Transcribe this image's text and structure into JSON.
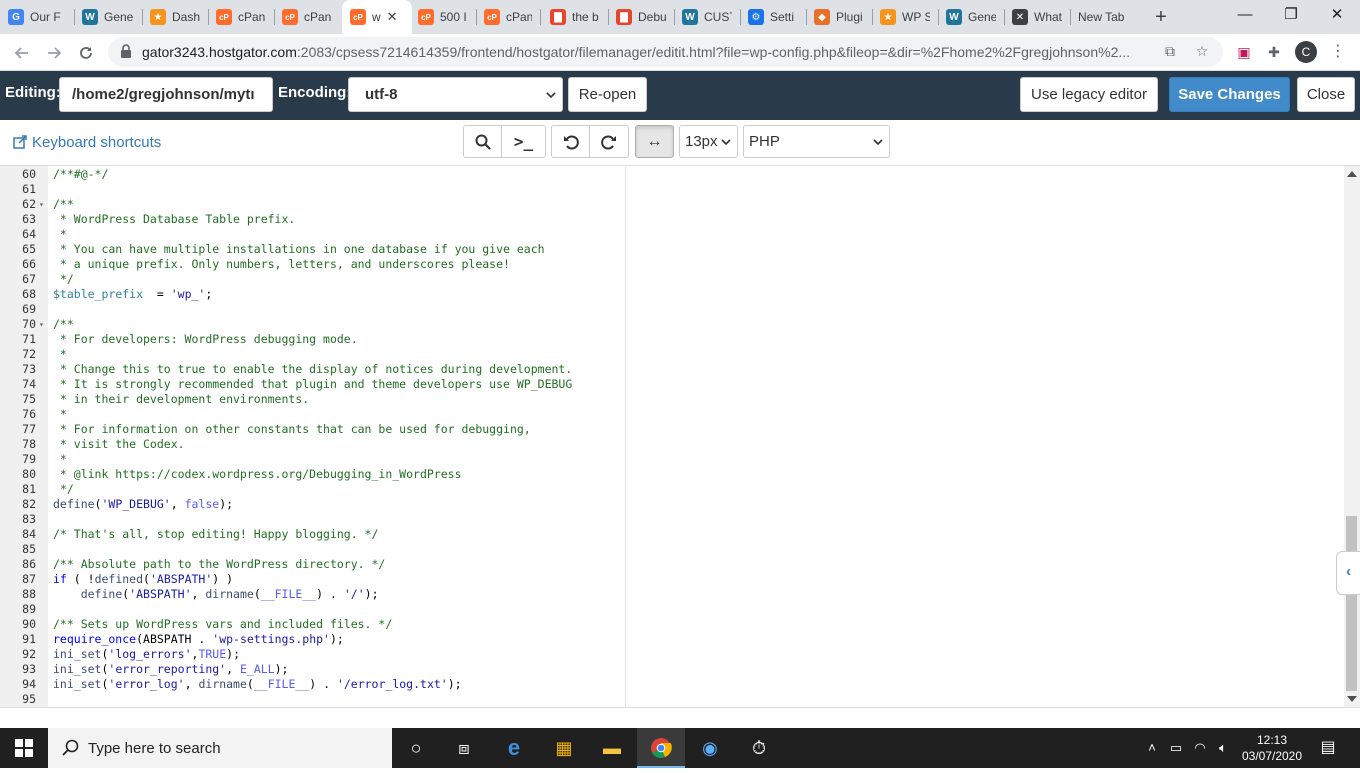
{
  "browser": {
    "tabs": [
      {
        "label": "Our F",
        "icon": "google-icon",
        "color": "#4285f4",
        "glyph": "G"
      },
      {
        "label": "Gene",
        "icon": "wordpress-icon",
        "color": "#21759b",
        "glyph": "W"
      },
      {
        "label": "Dash",
        "icon": "hostgator-icon",
        "color": "#f7941d",
        "glyph": "★"
      },
      {
        "label": "cPan",
        "icon": "cpanel-icon",
        "color": "#ff6c2c",
        "glyph": "cP"
      },
      {
        "label": "cPan",
        "icon": "cpanel-icon",
        "color": "#ff6c2c",
        "glyph": "cP"
      },
      {
        "label": "w",
        "icon": "cpanel-icon",
        "color": "#ff6c2c",
        "glyph": "cP"
      },
      {
        "label": "500 I",
        "icon": "cpanel-icon",
        "color": "#ff6c2c",
        "glyph": "cP"
      },
      {
        "label": "cPan",
        "icon": "cpanel-icon",
        "color": "#ff6c2c",
        "glyph": "cP"
      },
      {
        "label": "the b",
        "icon": "bag-icon",
        "color": "#e8452c",
        "glyph": "▇"
      },
      {
        "label": "Debu",
        "icon": "bag-icon",
        "color": "#e8452c",
        "glyph": "▇"
      },
      {
        "label": "CUST",
        "icon": "wordpress-icon",
        "color": "#21759b",
        "glyph": "W"
      },
      {
        "label": "Setti",
        "icon": "gear-icon",
        "color": "#1a73e8",
        "glyph": "⚙"
      },
      {
        "label": "Plugi",
        "icon": "plugin-icon",
        "color": "#e8702a",
        "glyph": "◆"
      },
      {
        "label": "WP S",
        "icon": "hostgator-icon",
        "color": "#f7941d",
        "glyph": "★"
      },
      {
        "label": "Gene",
        "icon": "wordpress-icon",
        "color": "#21759b",
        "glyph": "W"
      },
      {
        "label": "What",
        "icon": "crossed-icon",
        "color": "#3c4043",
        "glyph": "✕"
      },
      {
        "label": "New Tab",
        "icon": "",
        "color": "",
        "glyph": ""
      }
    ],
    "new_tab_label": "+",
    "window": {
      "minimize": "—",
      "restore": "❐",
      "close": "✕"
    },
    "url_host": "gator3243.hostgator.com",
    "url_rest": ":2083/cpsess7214614359/frontend/hostgator/filemanager/editit.html?file=wp-config.php&fileop=&dir=%2Fhome2%2Fgregjohnson%2...",
    "profile_initial": "C"
  },
  "header": {
    "editing_label": "Editing:",
    "path_value": "/home2/gregjohnson/mytı",
    "encoding_label": "Encoding:",
    "encoding_value": "utf-8",
    "reopen_label": "Re-open",
    "legacy_label": "Use legacy editor",
    "save_label": "Save Changes",
    "close_label": "Close"
  },
  "toolbar": {
    "shortcuts_label": "Keyboard shortcuts",
    "font_size": "13px",
    "language": "PHP"
  },
  "editor": {
    "lines": [
      {
        "n": "60",
        "fold": false,
        "html": "<span class=\"c\">/**#@-*/</span>"
      },
      {
        "n": "61",
        "fold": false,
        "html": ""
      },
      {
        "n": "62",
        "fold": true,
        "html": "<span class=\"c\">/**</span>"
      },
      {
        "n": "63",
        "fold": false,
        "html": "<span class=\"c\"> * WordPress Database Table prefix.</span>"
      },
      {
        "n": "64",
        "fold": false,
        "html": "<span class=\"c\"> *</span>"
      },
      {
        "n": "65",
        "fold": false,
        "html": "<span class=\"c\"> * You can have multiple installations in one database if you give each</span>"
      },
      {
        "n": "66",
        "fold": false,
        "html": "<span class=\"c\"> * a unique prefix. Only numbers, letters, and underscores please!</span>"
      },
      {
        "n": "67",
        "fold": false,
        "html": "<span class=\"c\"> */</span>"
      },
      {
        "n": "68",
        "fold": false,
        "html": "<span class=\"v\">$table_prefix</span>  = <span class=\"s\">'wp_'</span>;"
      },
      {
        "n": "69",
        "fold": false,
        "html": ""
      },
      {
        "n": "70",
        "fold": true,
        "html": "<span class=\"c\">/**</span>"
      },
      {
        "n": "71",
        "fold": false,
        "html": "<span class=\"c\"> * For developers: WordPress debugging mode.</span>"
      },
      {
        "n": "72",
        "fold": false,
        "html": "<span class=\"c\"> *</span>"
      },
      {
        "n": "73",
        "fold": false,
        "html": "<span class=\"c\"> * Change this to true to enable the display of notices during development.</span>"
      },
      {
        "n": "74",
        "fold": false,
        "html": "<span class=\"c\"> * It is strongly recommended that plugin and theme developers use WP_DEBUG</span>"
      },
      {
        "n": "75",
        "fold": false,
        "html": "<span class=\"c\"> * in their development environments.</span>"
      },
      {
        "n": "76",
        "fold": false,
        "html": "<span class=\"c\"> *</span>"
      },
      {
        "n": "77",
        "fold": false,
        "html": "<span class=\"c\"> * For information on other constants that can be used for debugging,</span>"
      },
      {
        "n": "78",
        "fold": false,
        "html": "<span class=\"c\"> * visit the Codex.</span>"
      },
      {
        "n": "79",
        "fold": false,
        "html": "<span class=\"c\"> *</span>"
      },
      {
        "n": "80",
        "fold": false,
        "html": "<span class=\"c\"> * @link https://codex.wordpress.org/Debugging_in_WordPress</span>"
      },
      {
        "n": "81",
        "fold": false,
        "html": "<span class=\"c\"> */</span>"
      },
      {
        "n": "82",
        "fold": false,
        "html": "<span class=\"f\">define</span>(<span class=\"s\">'WP_DEBUG'</span>, <span class=\"b\">false</span>);"
      },
      {
        "n": "83",
        "fold": false,
        "html": ""
      },
      {
        "n": "84",
        "fold": false,
        "html": "<span class=\"c\">/* That's all, stop editing! Happy blogging. */</span>"
      },
      {
        "n": "85",
        "fold": false,
        "html": ""
      },
      {
        "n": "86",
        "fold": false,
        "html": "<span class=\"c\">/** Absolute path to the WordPress directory. */</span>"
      },
      {
        "n": "87",
        "fold": false,
        "html": "<span class=\"k\">if</span> ( !<span class=\"f\">defined</span>(<span class=\"s\">'ABSPATH'</span>) )"
      },
      {
        "n": "88",
        "fold": false,
        "html": "    <span class=\"f\">define</span>(<span class=\"s\">'ABSPATH'</span>, <span class=\"f\">dirname</span>(<span class=\"b\">__FILE__</span>) . <span class=\"s\">'/'</span>);"
      },
      {
        "n": "89",
        "fold": false,
        "html": ""
      },
      {
        "n": "90",
        "fold": false,
        "html": "<span class=\"c\">/** Sets up WordPress vars and included files. */</span>"
      },
      {
        "n": "91",
        "fold": false,
        "html": "<span class=\"k\">require_once</span>(ABSPATH . <span class=\"s\">'wp-settings.php'</span>);"
      },
      {
        "n": "92",
        "fold": false,
        "html": "<span class=\"f\">ini_set</span>(<span class=\"s\">'log_errors'</span>,<span class=\"b\">TRUE</span>);"
      },
      {
        "n": "93",
        "fold": false,
        "html": "<span class=\"f\">ini_set</span>(<span class=\"s\">'error_reporting'</span>, <span class=\"b\">E_ALL</span>);"
      },
      {
        "n": "94",
        "fold": false,
        "html": "<span class=\"f\">ini_set</span>(<span class=\"s\">'error_log'</span>, <span class=\"f\">dirname</span>(<span class=\"b\">__FILE__</span>) . <span class=\"s\">'/error_log.txt'</span>);"
      },
      {
        "n": "95",
        "fold": false,
        "html": ""
      }
    ]
  },
  "taskbar": {
    "search_placeholder": "Type here to search",
    "time": "12:13",
    "date": "03/07/2020"
  }
}
